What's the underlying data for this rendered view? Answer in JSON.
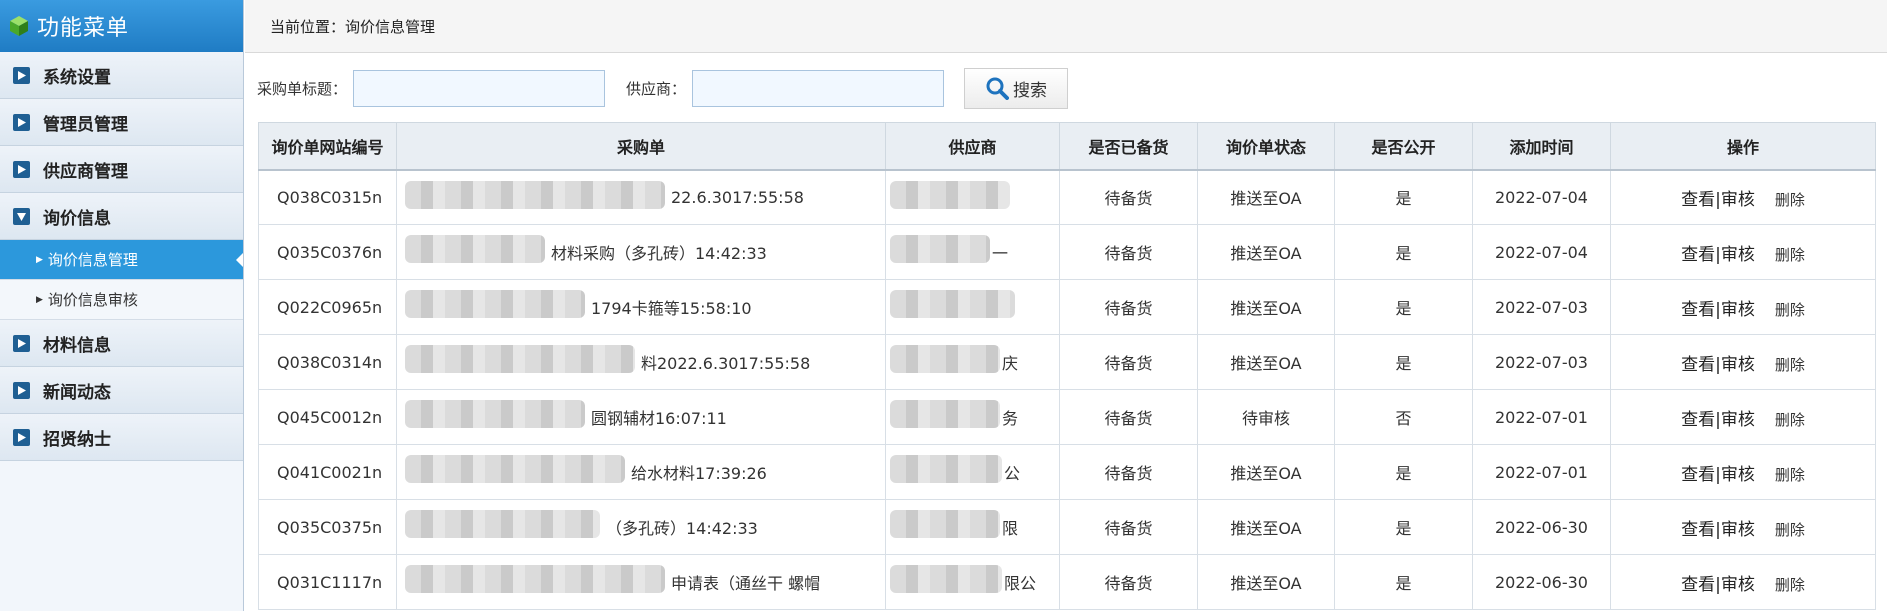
{
  "sidebar": {
    "title": "功能菜单",
    "menu": [
      {
        "label": "系统设置"
      },
      {
        "label": "管理员管理"
      },
      {
        "label": "供应商管理"
      },
      {
        "label": "询价信息",
        "open": true
      }
    ],
    "submenu": [
      {
        "label": "询价信息管理",
        "active": true
      },
      {
        "label": "询价信息审核"
      }
    ],
    "menu2": [
      {
        "label": "材料信息"
      },
      {
        "label": "新闻动态"
      },
      {
        "label": "招贤纳士"
      }
    ]
  },
  "topbar": {
    "breadcrumb": "当前位置：询价信息管理"
  },
  "search": {
    "title_label": "采购单标题：",
    "title_value": "",
    "supplier_label": "供应商：",
    "supplier_value": "",
    "button_label": "搜索"
  },
  "table": {
    "headers": [
      "询价单网站编号",
      "采购单",
      "供应商",
      "是否已备货",
      "询价单状态",
      "是否公开",
      "添加时间",
      "操作"
    ],
    "rows": [
      {
        "code": "Q038C0315n",
        "order": "22.6.3017:55:58",
        "supplier": "",
        "stock": "待备货",
        "status": "推送至OA",
        "public": "是",
        "date": "2022-07-04"
      },
      {
        "code": "Q035C0376n",
        "order": "材料采购（多孔砖）14:42:33",
        "supplier": "一",
        "stock": "待备货",
        "status": "推送至OA",
        "public": "是",
        "date": "2022-07-04"
      },
      {
        "code": "Q022C0965n",
        "order": "1794卡箍等15:58:10",
        "supplier": "",
        "stock": "待备货",
        "status": "推送至OA",
        "public": "是",
        "date": "2022-07-03"
      },
      {
        "code": "Q038C0314n",
        "order": "料2022.6.3017:55:58",
        "supplier": "庆",
        "stock": "待备货",
        "status": "推送至OA",
        "public": "是",
        "date": "2022-07-03"
      },
      {
        "code": "Q045C0012n",
        "order": "圆钢辅材16:07:11",
        "supplier": "务",
        "stock": "待备货",
        "status": "待审核",
        "public": "否",
        "date": "2022-07-01"
      },
      {
        "code": "Q041C0021n",
        "order": "给水材料17:39:26",
        "supplier": "公",
        "stock": "待备货",
        "status": "推送至OA",
        "public": "是",
        "date": "2022-07-01"
      },
      {
        "code": "Q035C0375n",
        "order": "（多孔砖）14:42:33",
        "supplier": "限",
        "stock": "待备货",
        "status": "推送至OA",
        "public": "是",
        "date": "2022-06-30"
      },
      {
        "code": "Q031C1117n",
        "order": "申请表（通丝干 螺帽",
        "supplier": "限公",
        "stock": "待备货",
        "status": "推送至OA",
        "public": "是",
        "date": "2022-06-30"
      }
    ],
    "op_view": "查看",
    "op_sep": "|",
    "op_audit": "审核",
    "op_delete": "删除"
  }
}
